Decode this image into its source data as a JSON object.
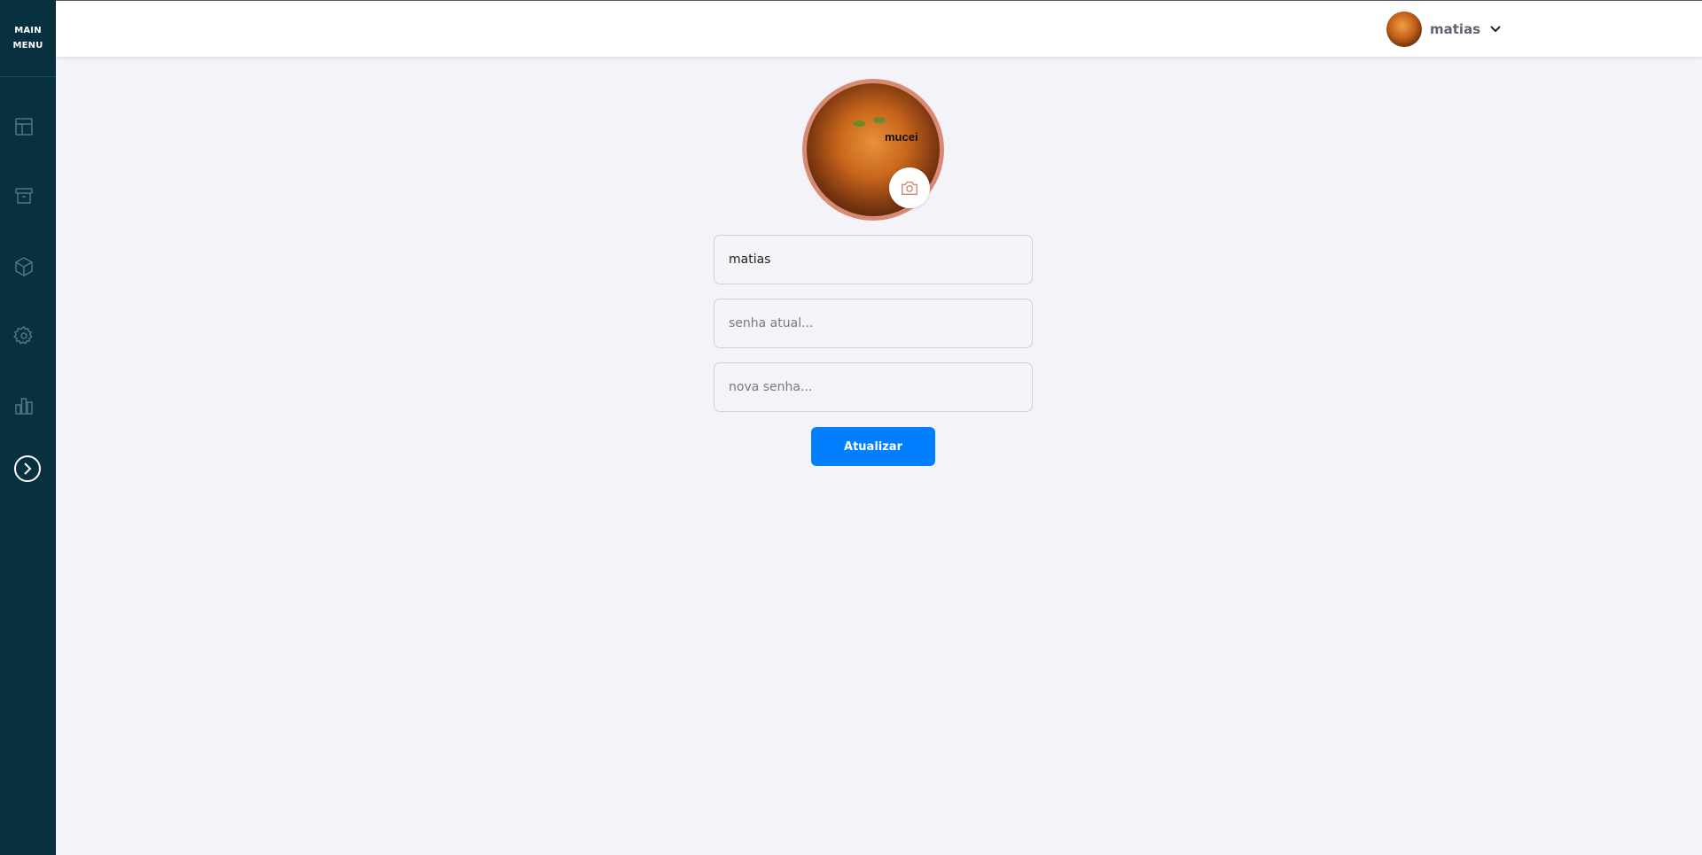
{
  "sidebar": {
    "title": "MAIN\nMENU",
    "title_line1": "MAIN",
    "title_line2": "MENU",
    "items": [
      {
        "icon": "layout-icon"
      },
      {
        "icon": "archive-icon"
      },
      {
        "icon": "box-icon"
      },
      {
        "icon": "settings-icon"
      },
      {
        "icon": "bar-chart-icon"
      }
    ],
    "expand_icon": "chevron-right-circle-icon"
  },
  "header": {
    "username": "matias",
    "dropdown_icon": "chevron-down-icon"
  },
  "profile": {
    "avatar_caption": "mucei",
    "name_value": "matias",
    "current_password_placeholder": "senha atual...",
    "new_password_placeholder": "nova senha...",
    "submit_label": "Atualizar"
  },
  "colors": {
    "sidebar_bg": "#083140",
    "page_bg": "#f4f3fa",
    "accent": "#0080fe",
    "avatar_border": "#d98a72"
  }
}
